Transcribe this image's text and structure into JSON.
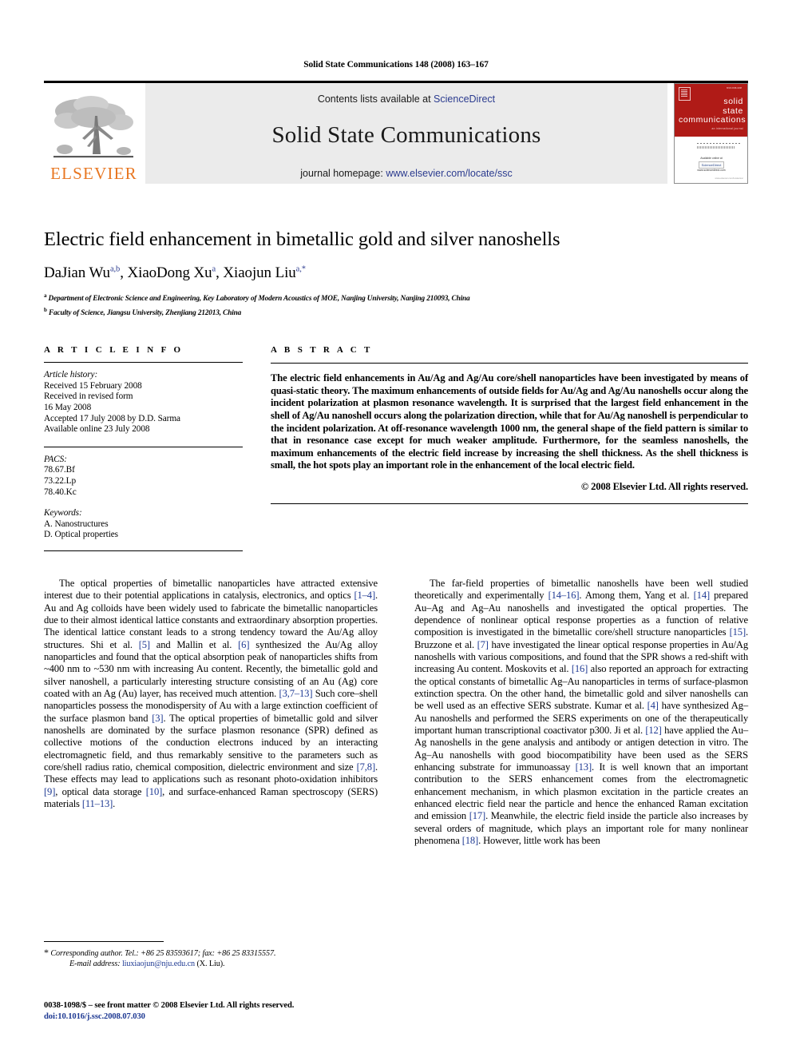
{
  "running_head": "Solid State Communications 148 (2008) 163–167",
  "masthead": {
    "publisher_name": "ELSEVIER",
    "contents_prefix": "Contents lists available at ",
    "contents_link": "ScienceDirect",
    "journal_title": "Solid State Communications",
    "homepage_prefix": "journal homepage: ",
    "homepage_link": "www.elsevier.com/locate/ssc",
    "cover": {
      "line1": "solid",
      "line2": "state",
      "line3": "communications",
      "subtitle": "an international journal",
      "tagline": "a leading short communications",
      "sd_caption": "Available online at",
      "sd_badge": "ScienceDirect",
      "sd_url": "www.sciencedirect.com",
      "bottom_note": "www.elsevier.com/locate/ssc"
    }
  },
  "article": {
    "title": "Electric field enhancement in bimetallic gold and silver nanoshells",
    "authors": [
      {
        "name": "DaJian Wu",
        "sup": "a,b"
      },
      {
        "name": "XiaoDong Xu",
        "sup": "a"
      },
      {
        "name": "Xiaojun Liu",
        "sup": "a,*"
      }
    ],
    "affiliations": [
      {
        "marker": "a",
        "text": "Department of Electronic Science and Engineering, Key Laboratory of Modern Acoustics of MOE, Nanjing University, Nanjing 210093, China"
      },
      {
        "marker": "b",
        "text": "Faculty of Science, Jiangsu University, Zhenjiang 212013, China"
      }
    ]
  },
  "article_info": {
    "heading": "A R T I C L E   I N F O",
    "history_label": "Article history:",
    "history": [
      "Received 15 February 2008",
      "Received in revised form",
      "16 May 2008",
      "Accepted 17 July 2008 by D.D. Sarma",
      "Available online 23 July 2008"
    ],
    "pacs_label": "PACS:",
    "pacs": [
      "78.67.Bf",
      "73.22.Lp",
      "78.40.Kc"
    ],
    "keywords_label": "Keywords:",
    "keywords": [
      "A. Nanostructures",
      "D. Optical properties"
    ]
  },
  "abstract": {
    "heading": "A B S T R A C T",
    "text": "The electric field enhancements in Au/Ag and Ag/Au core/shell nanoparticles have been investigated by means of quasi-static theory. The maximum enhancements of outside fields for Au/Ag and Ag/Au nanoshells occur along the incident polarization at plasmon resonance wavelength. It is surprised that the largest field enhancement in the shell of Ag/Au nanoshell occurs along the polarization direction, while that for Au/Ag nanoshell is perpendicular to the incident polarization. At off-resonance wavelength 1000 nm, the general shape of the field pattern is similar to that in resonance case except for much weaker amplitude. Furthermore, for the seamless nanoshells, the maximum enhancements of the electric field increase by increasing the shell thickness. As the shell thickness is small, the hot spots play an important role in the enhancement of the local electric field.",
    "copyright": "© 2008 Elsevier Ltd. All rights reserved."
  },
  "body": {
    "left_paragraph": "The optical properties of bimetallic nanoparticles have attracted extensive interest due to their potential applications in catalysis, electronics, and optics [1–4]. Au and Ag colloids have been widely used to fabricate the bimetallic nanoparticles due to their almost identical lattice constants and extraordinary absorption properties. The identical lattice constant leads to a strong tendency toward the Au/Ag alloy structures. Shi et al. [5] and Mallin et al. [6] synthesized the Au/Ag alloy nanoparticles and found that the optical absorption peak of nanoparticles shifts from ~400 nm to ~530 nm with increasing Au content. Recently, the bimetallic gold and silver nanoshell, a particularly interesting structure consisting of an Au (Ag) core coated with an Ag (Au) layer, has received much attention. [3,7–13] Such core–shell nanoparticles possess the monodispersity of Au with a large extinction coefficient of the surface plasmon band [3]. The optical properties of bimetallic gold and silver nanoshells are dominated by the surface plasmon resonance (SPR) defined as collective motions of the conduction electrons induced by an interacting electromagnetic field, and thus remarkably sensitive to the parameters such as core/shell radius ratio, chemical composition, dielectric environment and size [7,8]. These effects may lead to applications such as resonant photo-oxidation inhibitors [9], optical data storage [10], and surface-enhanced Raman spectroscopy (SERS) materials [11–13].",
    "right_paragraph": "The far-field properties of bimetallic nanoshells have been well studied theoretically and experimentally [14–16]. Among them, Yang et al. [14] prepared Au–Ag and Ag–Au nanoshells and investigated the optical properties. The dependence of nonlinear optical response properties as a function of relative composition is investigated in the bimetallic core/shell structure nanoparticles [15]. Bruzzone et al. [7] have investigated the linear optical response properties in Au/Ag nanoshells with various compositions, and found that the SPR shows a red-shift with increasing Au content. Moskovits et al. [16] also reported an approach for extracting the optical constants of bimetallic Ag–Au nanoparticles in terms of surface-plasmon extinction spectra. On the other hand, the bimetallic gold and silver nanoshells can be well used as an effective SERS substrate. Kumar et al. [4] have synthesized Ag–Au nanoshells and performed the SERS experiments on one of the therapeutically important human transcriptional coactivator p300. Ji et al. [12] have applied the Au–Ag nanoshells in the gene analysis and antibody or antigen detection in vitro. The Ag–Au nanoshells with good biocompatibility have been used as the SERS enhancing substrate for immunoassay [13]. It is well known that an important contribution to the SERS enhancement comes from the electromagnetic enhancement mechanism, in which plasmon excitation in the particle creates an enhanced electric field near the particle and hence the enhanced Raman excitation and emission [17]. Meanwhile, the electric field inside the particle also increases by several orders of magnitude, which plays an important role for many nonlinear phenomena [18]. However, little work has been"
  },
  "footnote": {
    "corresponding": "Corresponding author. Tel.: +86 25 83593617; fax: +86 25 83315557.",
    "email_label": "E-mail address:",
    "email": "liuxiaojun@nju.edu.cn",
    "email_suffix": "(X. Liu)."
  },
  "imprint": {
    "line1": "0038-1098/$ – see front matter © 2008 Elsevier Ltd. All rights reserved.",
    "doi": "doi:10.1016/j.ssc.2008.07.030"
  },
  "colors": {
    "link_blue": "#2b3b8f",
    "ref_blue": "#1f3a93",
    "elsevier_orange": "#E87722",
    "band_gray": "#ebebeb",
    "cover_red": "#b01b17"
  }
}
